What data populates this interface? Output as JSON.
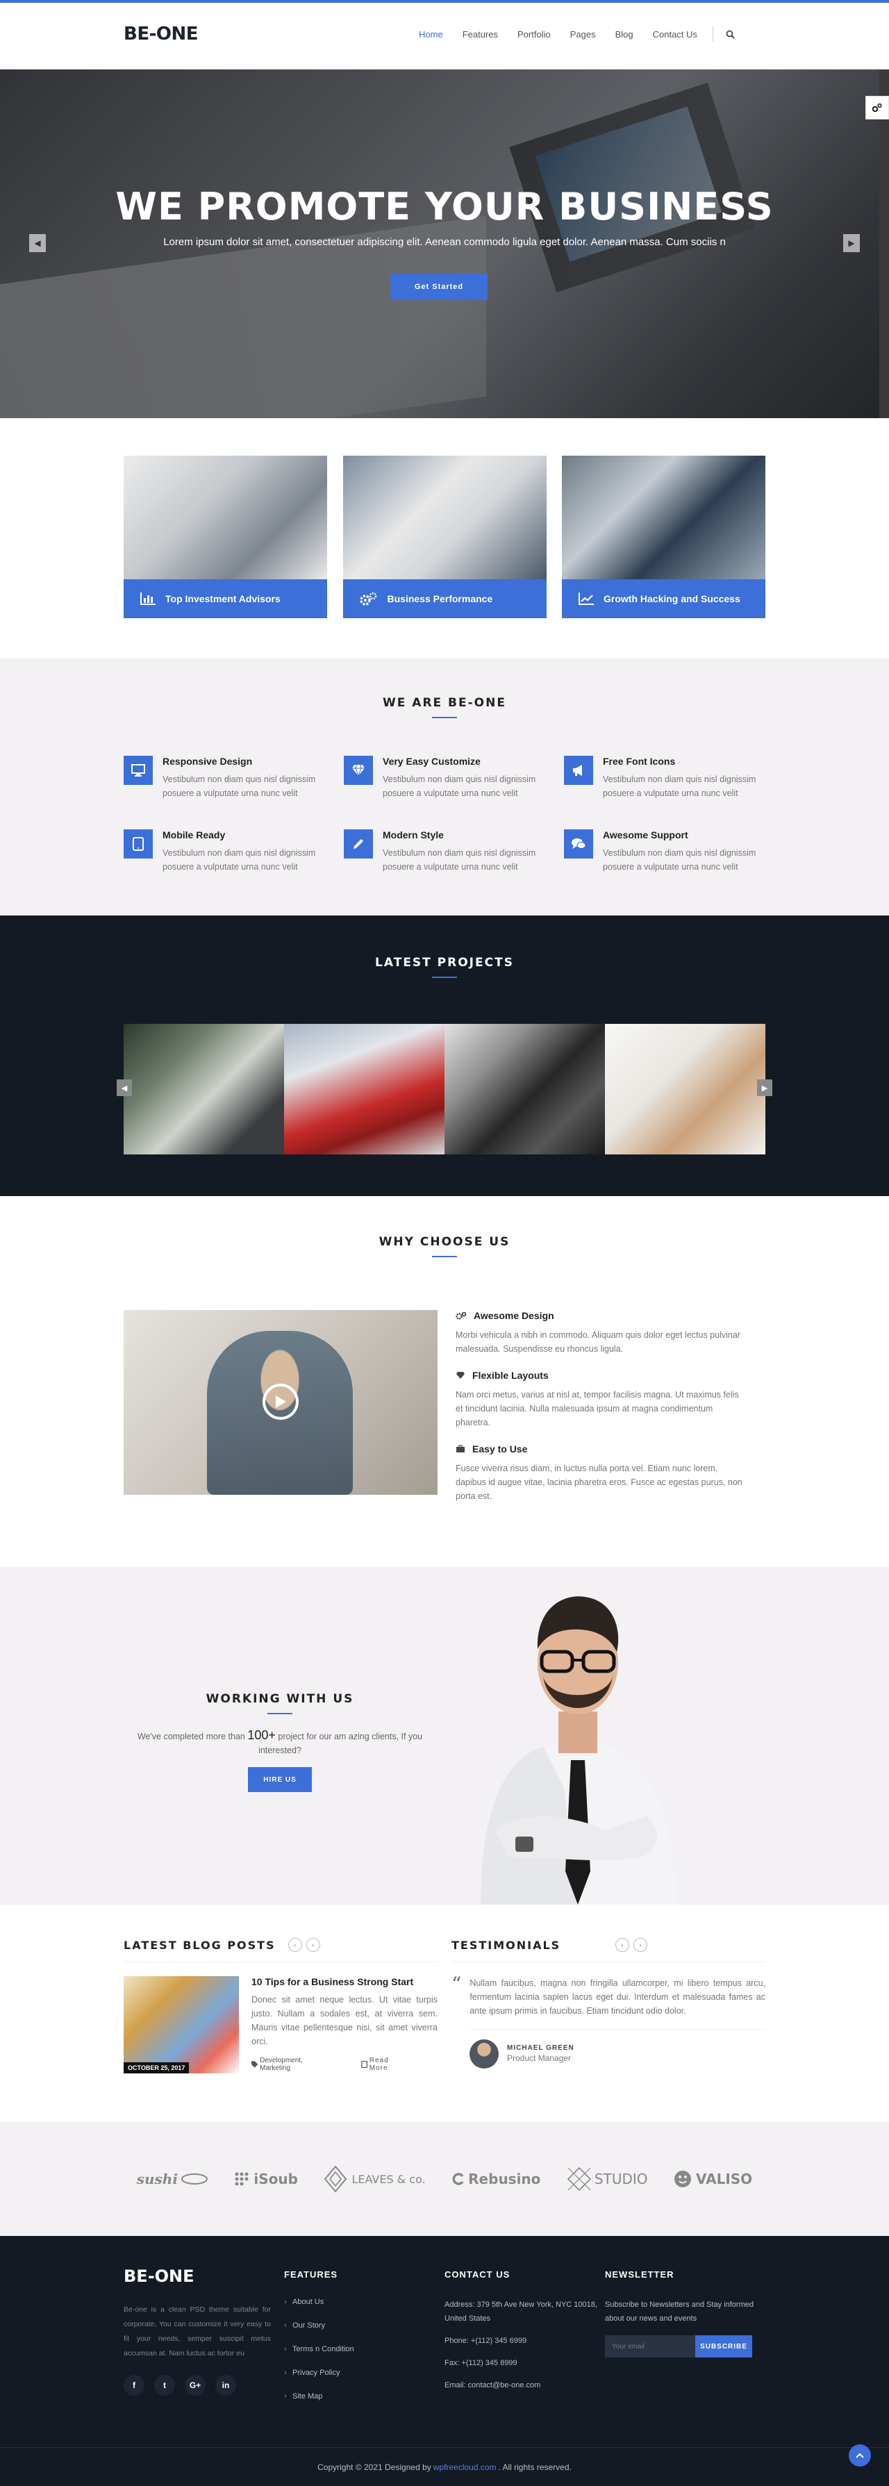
{
  "brand": {
    "logo": "BE-ONE",
    "accent": "#3c6fd8",
    "dark": "#131a24"
  },
  "nav": {
    "items": [
      "Home",
      "Features",
      "Portfolio",
      "Pages",
      "Blog",
      "Contact Us"
    ],
    "active": "Home",
    "search_icon": "search-icon"
  },
  "hero": {
    "title": "WE PROMOTE YOUR BUSINESS",
    "subtitle": "Lorem ipsum dolor sit amet, consectetuer adipiscing elit. Aenean commodo ligula eget dolor. Aenean massa. Cum sociis n",
    "cta": "Get Started",
    "prev_icon": "chevron-left-icon",
    "next_icon": "chevron-right-icon"
  },
  "services": [
    {
      "label": "Top Investment Advisors",
      "icon": "bar-chart-icon"
    },
    {
      "label": "Business Performance",
      "icon": "gears-icon"
    },
    {
      "label": "Growth Hacking and Success",
      "icon": "line-chart-icon"
    }
  ],
  "features": {
    "title": "WE ARE BE-ONE",
    "items": [
      {
        "title": "Responsive Design",
        "text": "Vestibulum non diam quis nisl dignissim posuere a vulputate urna nunc velit",
        "icon": "desktop-icon"
      },
      {
        "title": "Very Easy Customize",
        "text": "Vestibulum non diam quis nisl dignissim posuere a vulputate urna nunc velit",
        "icon": "diamond-icon"
      },
      {
        "title": "Free Font Icons",
        "text": "Vestibulum non diam quis nisl dignissim posuere a vulputate urna nunc velit",
        "icon": "bullhorn-icon"
      },
      {
        "title": "Mobile Ready",
        "text": "Vestibulum non diam quis nisl dignissim posuere a vulputate urna nunc velit",
        "icon": "tablet-icon"
      },
      {
        "title": "Modern Style",
        "text": "Vestibulum non diam quis nisl dignissim posuere a vulputate urna nunc velit",
        "icon": "pencil-icon"
      },
      {
        "title": "Awesome Support",
        "text": "Vestibulum non diam quis nisl dignissim posuere a vulputate urna nunc velit",
        "icon": "chat-icon"
      }
    ]
  },
  "projects": {
    "title": "LATEST PROJECTS"
  },
  "why": {
    "title": "WHY CHOOSE US",
    "items": [
      {
        "title": "Awesome Design",
        "text": "Morbi vehicula a nibh in commodo. Aliquam quis dolor eget lectus pulvinar malesuada. Suspendisse eu rhoncus ligula.",
        "icon": "cogs-icon"
      },
      {
        "title": "Flexible Layouts",
        "text": "Nam orci metus, varius at nisl at, tempor facilisis magna. Ut maximus felis et tincidunt lacinia. Nulla malesuada ipsum at magna condimentum pharetra.",
        "icon": "diamond-icon"
      },
      {
        "title": "Easy to Use",
        "text": "Fusce viverra risus diam, in luctus nulla porta vel. Etiam nunc lorem, dapibus id augue vitae, lacinia pharetra eros. Fusce ac egestas purus, non porta est.",
        "icon": "briefcase-icon"
      }
    ]
  },
  "working": {
    "title": "WORKING WITH US",
    "text_before": "We've completed more than",
    "number": "100+",
    "text_after": "project for our am azing clients, If you interested?",
    "button": "HIRE US"
  },
  "blog": {
    "title": "LATEST BLOG POSTS",
    "post": {
      "date": "OCTOBER 25, 2017",
      "title": "10 Tips for a Business Strong Start",
      "text": "Donec sit amet neque lectus. Ut vitae turpis justo. Nullam a sodales est, at viverra sem. Mauris vitae pellentesque nisi, sit amet viverra orci.",
      "tags": "Development, Marketing",
      "read_more": "Read More"
    }
  },
  "testimonials": {
    "title": "TESTIMONIALS",
    "quote": "Nullam faucibus, magna non fringilla ullamcorper, mi libero tempus arcu, fermentum lacinia sapien lacus eget dui. Interdum et malesuada fames ac ante ipsum primis in faucibus. Etiam tincidunt odio dolor.",
    "name": "MICHAEL GREEN",
    "role": "Product Manager"
  },
  "partners": [
    "sushi",
    "iSoub",
    "LEAVES & co.",
    "Rebusino",
    "STUDIO",
    "VALISO"
  ],
  "footer": {
    "logo": "BE-ONE",
    "about": "Be-one is a clean PSD theme suitable for corporate, You can customize it very easy to fit your needs, semper suscipit metus accumsan at. Nam luctus ac tortor eu",
    "socials": [
      "f",
      "t",
      "G+",
      "in"
    ],
    "features_title": "FEATURES",
    "links": [
      "About Us",
      "Our Story",
      "Terms n Condition",
      "Privacy Policy",
      "Site Map"
    ],
    "contact_title": "CONTACT US",
    "address": "Address: 379 5th Ave New York, NYC 10018, United States",
    "phone": "Phone: +(112) 345 6999",
    "fax": "Fax: +(112) 345 8999",
    "email": "Email: contact@be-one.com",
    "newsletter_title": "NEWSLETTER",
    "newsletter_text": "Subscribe to Newsletters and Stay informed about our news and events",
    "email_placeholder": "Your email",
    "subscribe": "SUBSCRIBE",
    "copyright_before": "Copyright © 2021 Designed by",
    "copyright_link": "wpfreecloud.com",
    "copyright_after": ". All rights reserved."
  }
}
